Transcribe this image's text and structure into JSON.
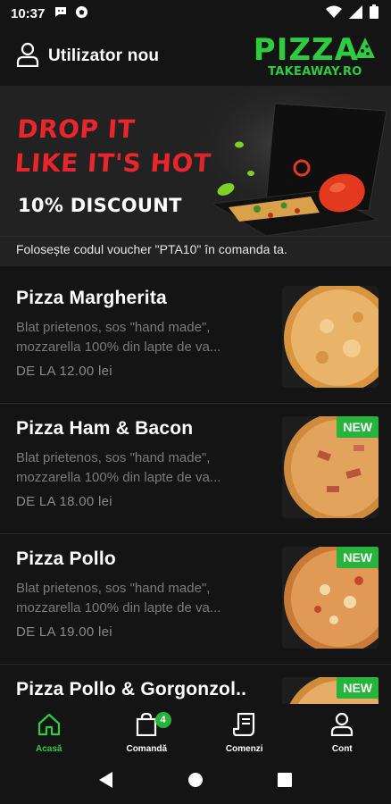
{
  "status_bar": {
    "time": "10:37",
    "icons": [
      "chat-notif-icon",
      "soccer-notif-icon",
      "wifi-icon",
      "signal-icon",
      "battery-icon"
    ]
  },
  "header": {
    "user_label": "Utilizator nou",
    "logo_word": "PIZZA",
    "logo_sub": "TAKEAWAY.RO"
  },
  "banner": {
    "title_line1": "DROP IT",
    "title_line2": "LIKE IT'S HOT",
    "subtitle": "10% DISCOUNT",
    "voucher_text": "Folosește codul voucher \"PTA10\" în comanda ta."
  },
  "products": [
    {
      "name": "Pizza Margherita",
      "desc_line1": "Blat prietenos, sos \"hand made\",",
      "desc_line2": "mozzarella 100% din lapte de va...",
      "price": "DE LA 12.00 lei",
      "badge": ""
    },
    {
      "name": "Pizza Ham & Bacon",
      "desc_line1": "Blat prietenos, sos \"hand made\",",
      "desc_line2": "mozzarella 100% din lapte de va...",
      "price": "DE LA 18.00 lei",
      "badge": "NEW"
    },
    {
      "name": "Pizza Pollo",
      "desc_line1": "Blat prietenos, sos \"hand made\",",
      "desc_line2": "mozzarella 100% din lapte de va...",
      "price": "DE LA 19.00 lei",
      "badge": "NEW"
    },
    {
      "name": "Pizza Pollo & Gorgonzol..",
      "desc_line1": "",
      "desc_line2": "",
      "price": "",
      "badge": "NEW"
    }
  ],
  "bottom_nav": {
    "home": "Acasă",
    "order": "Comandă",
    "order_count": "4",
    "orders": "Comenzi",
    "account": "Cont"
  },
  "colors": {
    "accent": "#2ecc40",
    "banner_red": "#e8262c",
    "background": "#141414"
  }
}
